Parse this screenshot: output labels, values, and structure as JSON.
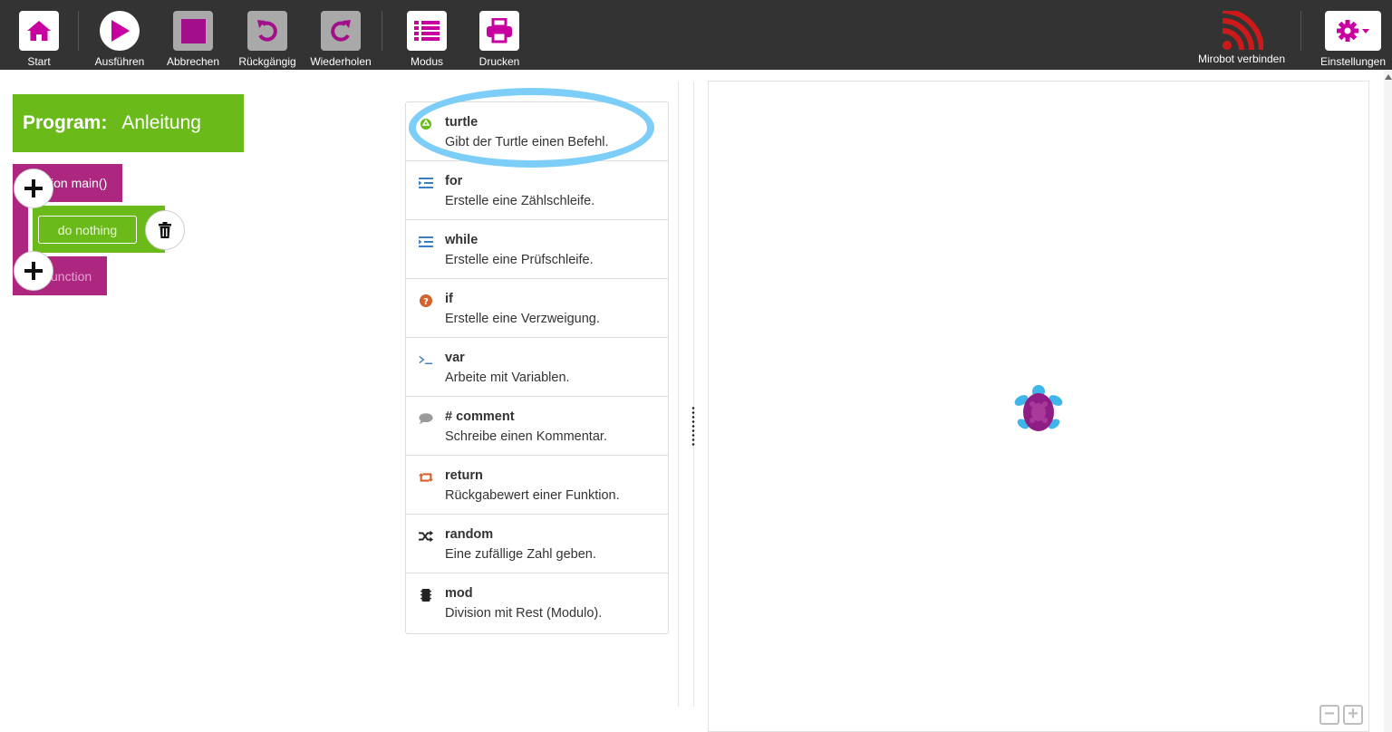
{
  "toolbar": {
    "start": "Start",
    "run": "Ausführen",
    "stop": "Abbrechen",
    "undo": "Rückgängig",
    "redo": "Wiederholen",
    "mode": "Modus",
    "print": "Drucken",
    "mirobot": "Mirobot verbinden",
    "settings": "Einstellungen"
  },
  "program": {
    "label": "Program:",
    "name": "Anleitung",
    "main_block": "ion main()",
    "body_button": "do nothing",
    "end_block": "unction"
  },
  "commands": [
    {
      "name": "turtle",
      "desc": "Gibt der Turtle einen Befehl.",
      "icon": "recycle-icon"
    },
    {
      "name": "for",
      "desc": "Erstelle eine Zählschleife.",
      "icon": "indent-icon"
    },
    {
      "name": "while",
      "desc": "Erstelle eine Prüfschleife.",
      "icon": "indent-icon"
    },
    {
      "name": "if",
      "desc": "Erstelle eine Verzweigung.",
      "icon": "question-circle-icon"
    },
    {
      "name": "var",
      "desc": "Arbeite mit Variablen.",
      "icon": "terminal-icon"
    },
    {
      "name": "# comment",
      "desc": "Schreibe einen Kommentar.",
      "icon": "comment-icon"
    },
    {
      "name": "return",
      "desc": "Rückgabewert einer Funktion.",
      "icon": "retweet-icon"
    },
    {
      "name": "random",
      "desc": "Eine zufällige Zahl geben.",
      "icon": "shuffle-icon"
    },
    {
      "name": "mod",
      "desc": "Division mit Rest (Modulo).",
      "icon": "chip-icon"
    }
  ],
  "canvas": {
    "zoom_out": "−",
    "zoom_in": "+"
  },
  "colors": {
    "accent": "#c800a0",
    "program_green": "#6aba1a",
    "function_magenta": "#ad2780",
    "toolbar_bg": "#333333",
    "highlight": "#7ccdf8"
  }
}
